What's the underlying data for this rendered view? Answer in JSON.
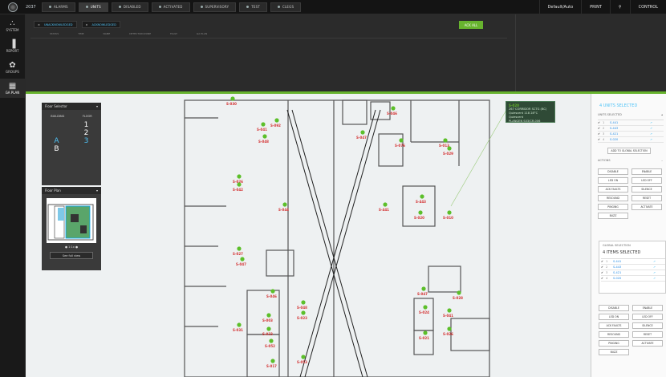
{
  "app": {
    "year": "2037",
    "account": "Default/Auto",
    "print_label": "PRINT",
    "search_icon": "search-icon",
    "control_label": "CONTROL"
  },
  "top_tabs": [
    {
      "label": "ALARMS",
      "active": false
    },
    {
      "label": "UNITS",
      "active": true
    },
    {
      "label": "DISABLED",
      "active": false
    },
    {
      "label": "ACTIVATED",
      "active": false
    },
    {
      "label": "SUPERVISORY",
      "active": false
    },
    {
      "label": "TEST",
      "active": false
    },
    {
      "label": "CLEGS",
      "active": false
    }
  ],
  "sidebar": [
    {
      "label": "SYSTEM",
      "icon": "network-icon"
    },
    {
      "label": "REPORT",
      "icon": "chart-icon"
    },
    {
      "label": "GROUPS",
      "icon": "groups-icon"
    },
    {
      "label": "GA PLAN",
      "icon": "plan-icon",
      "active": true
    }
  ],
  "alarms": {
    "subtabs": [
      {
        "label": "UNACKNOWLEDGED"
      },
      {
        "label": "ACKNOWLEDGED"
      }
    ],
    "ack_all": "ACK ALL",
    "columns": [
      "STATUS",
      "TIME",
      "NAME",
      "DETECTION ZONE",
      "FAULT",
      "GA PLAN"
    ]
  },
  "floor_selector": {
    "title": "Floor Selector",
    "col_building": "BUILDING",
    "col_floor": "FLOOR",
    "rows": [
      {
        "building": "",
        "floor": "1"
      },
      {
        "building": "",
        "floor": "2"
      },
      {
        "building": "A",
        "floor": "3",
        "selected": true
      },
      {
        "building": "B",
        "floor": ""
      }
    ]
  },
  "floor_plan": {
    "title": "Floor Plan",
    "zoom": "1:1x",
    "full_view": "See full view"
  },
  "callout": {
    "id": "S-020",
    "line1": "267 CORRIDOR SCTG (BC)",
    "line2": "Quiescent   118   28°C   Quiescent",
    "line3": "PLANGEN S03/CR-006"
  },
  "units_panel": {
    "title": "4 UNITS SELECTED",
    "section": "UNITS SELECTED",
    "rows": [
      {
        "no": "1",
        "name": "S-441"
      },
      {
        "no": "2",
        "name": "S-443"
      },
      {
        "no": "3",
        "name": "S-421"
      },
      {
        "no": "4",
        "name": "S-020"
      }
    ],
    "add_global": "ADD TO GLOBAL SELECTION",
    "actions_label": "ACTIONS",
    "actions": [
      "DISABLE",
      "ENABLE",
      "LED ON",
      "LED OFF",
      "ACK FAULTS",
      "SILENCE",
      "RESOUND",
      "RESET",
      "PINGING",
      "ACTIVATE",
      "BUZZ"
    ]
  },
  "global_panel": {
    "section": "GLOBAL SELECTION",
    "title": "4 ITEMS SELECTED",
    "units_col": "UNITS",
    "rows": [
      {
        "no": "1",
        "name": "S-441"
      },
      {
        "no": "2",
        "name": "S-443"
      },
      {
        "no": "3",
        "name": "S-421"
      },
      {
        "no": "4",
        "name": "S-020"
      }
    ],
    "actions": [
      "DISABLE",
      "ENABLE",
      "LED ON",
      "LED OFF",
      "ACK FAULTS",
      "SILENCE",
      "RESOUND",
      "RESET",
      "PINGING",
      "ACTIVATE",
      "BUZZ"
    ]
  },
  "map_points": [
    {
      "label": "S-030"
    },
    {
      "label": "S-041"
    },
    {
      "label": "S-092"
    },
    {
      "label": "S-048"
    },
    {
      "label": "S-046"
    },
    {
      "label": "S-047"
    },
    {
      "label": "S-076"
    },
    {
      "label": "S-013"
    },
    {
      "label": "S-029"
    },
    {
      "label": "S-026"
    },
    {
      "label": "S-042"
    },
    {
      "label": "S-044"
    },
    {
      "label": "S-441"
    },
    {
      "label": "S-443"
    },
    {
      "label": "S-020"
    },
    {
      "label": "S-010"
    },
    {
      "label": "S-027"
    },
    {
      "label": "S-047"
    },
    {
      "label": "S-046"
    },
    {
      "label": "S-048"
    },
    {
      "label": "S-023"
    },
    {
      "label": "S-031"
    },
    {
      "label": "S-003"
    },
    {
      "label": "S-023"
    },
    {
      "label": "S-052"
    },
    {
      "label": "S-017"
    },
    {
      "label": "S-053"
    },
    {
      "label": "S-047"
    },
    {
      "label": "S-024"
    },
    {
      "label": "S-021"
    },
    {
      "label": "S-028"
    },
    {
      "label": "S-041"
    },
    {
      "label": "S-026"
    }
  ],
  "colors": {
    "accent_green": "#67b32e",
    "accent_blue": "#4fc3f7",
    "point_green": "#5cbf2a",
    "label_red": "#d32f2f"
  }
}
